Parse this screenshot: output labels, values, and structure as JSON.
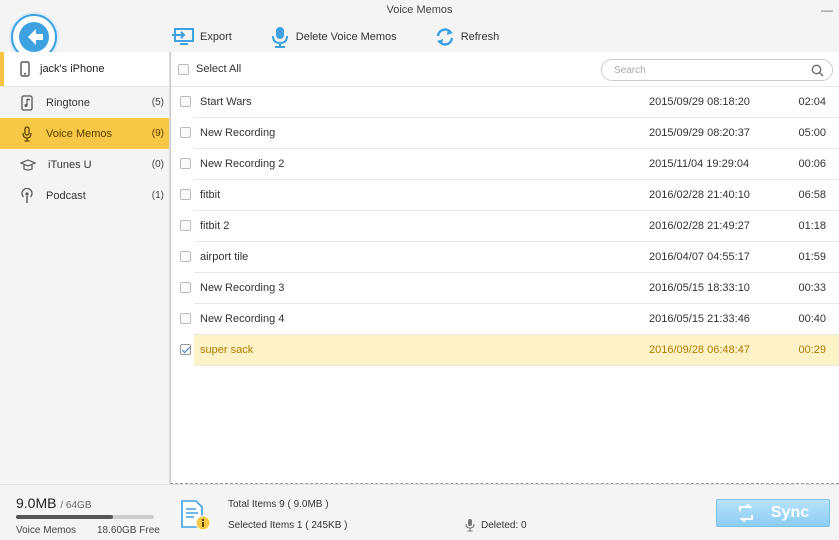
{
  "window": {
    "title": "Voice Memos",
    "minimize": "—"
  },
  "toolbar": {
    "export_label": "Export",
    "delete_label": "Delete Voice Memos",
    "refresh_label": "Refresh"
  },
  "sidebar": {
    "device_name": "jack's iPhone",
    "items": [
      {
        "label": "Ringtone",
        "count": "(5)",
        "icon": "ringtone-icon"
      },
      {
        "label": "Voice Memos",
        "count": "(9)",
        "icon": "microphone-icon",
        "active": true
      },
      {
        "label": "iTunes U",
        "count": "(0)",
        "icon": "graduation-cap-icon"
      },
      {
        "label": "Podcast",
        "count": "(1)",
        "icon": "podcast-icon"
      }
    ]
  },
  "list": {
    "select_all_label": "Select All",
    "search_placeholder": "Search",
    "rows": [
      {
        "title": "Start Wars",
        "date": "2015/09/29 08:18:20",
        "duration": "02:04",
        "checked": false
      },
      {
        "title": "New Recording",
        "date": "2015/09/29 08:20:37",
        "duration": "05:00",
        "checked": false
      },
      {
        "title": "New Recording 2",
        "date": "2015/11/04 19:29:04",
        "duration": "00:06",
        "checked": false
      },
      {
        "title": "fitbit",
        "date": "2016/02/28 21:40:10",
        "duration": "06:58",
        "checked": false
      },
      {
        "title": "fitbit 2",
        "date": "2016/02/28 21:49:27",
        "duration": "01:18",
        "checked": false
      },
      {
        "title": "airport tile",
        "date": "2016/04/07 04:55:17",
        "duration": "01:59",
        "checked": false
      },
      {
        "title": "New Recording 3",
        "date": "2016/05/15 18:33:10",
        "duration": "00:33",
        "checked": false
      },
      {
        "title": "New Recording 4",
        "date": "2016/05/15 21:33:46",
        "duration": "00:40",
        "checked": false
      },
      {
        "title": "super sack",
        "date": "2016/09/28 06:48:47",
        "duration": "00:29",
        "checked": true
      }
    ]
  },
  "footer": {
    "used": "9.0MB",
    "capacity": "/ 64GB",
    "usage_fraction": 0.7,
    "category": "Voice Memos",
    "free": "18.60GB Free",
    "total_items": "Total Items 9 ( 9.0MB )",
    "selected_items": "Selected Items 1 ( 245KB )",
    "deleted": "Deleted: 0",
    "sync_label": "Sync"
  },
  "colors": {
    "accent": "#f7c845",
    "back": "#3ea2e2",
    "sync": "#8ccdf3",
    "selected_row": "#fdf3c6"
  }
}
